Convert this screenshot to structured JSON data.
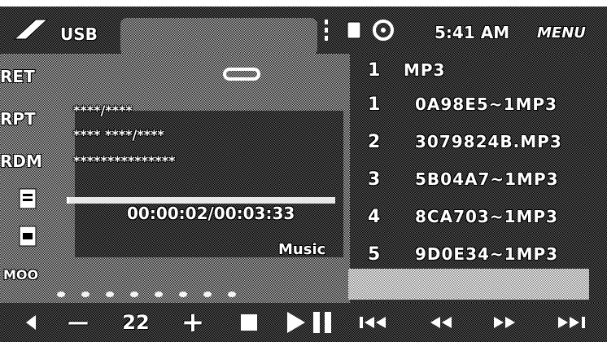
{
  "status_bar": {
    "source_label": "USB",
    "clock": "5:41 AM",
    "menu_label": "MENU",
    "icons": [
      "logo-icon",
      "signal-icon",
      "sd-card-icon",
      "disc-icon"
    ]
  },
  "info_pane": {
    "rows": [
      {
        "label": "RET",
        "value": ""
      },
      {
        "label": "RPT",
        "value": "****/****"
      },
      {
        "label": "",
        "value": "**** ****/****"
      },
      {
        "label": "RDM",
        "value": "***************"
      }
    ],
    "repeat_icon": "repeat-icon",
    "elapsed_time": "00:00:02/00:03:33",
    "progress": 0.01,
    "mode_label": "Music",
    "eq_label": "MOO"
  },
  "playlist": {
    "header": {
      "number": "1",
      "name": "MP3"
    },
    "items": [
      {
        "number": "1",
        "name": "0A98E5~1MP3"
      },
      {
        "number": "2",
        "name": "3079824B.MP3"
      },
      {
        "number": "3",
        "name": "5B04A7~1MP3"
      },
      {
        "number": "4",
        "name": "8CA703~1MP3"
      },
      {
        "number": "5",
        "name": "9D0E34~1MP3"
      }
    ]
  },
  "controls": {
    "volume": "22",
    "volume_down_label": "—",
    "volume_up_label": "+",
    "prev_label": "◂"
  }
}
